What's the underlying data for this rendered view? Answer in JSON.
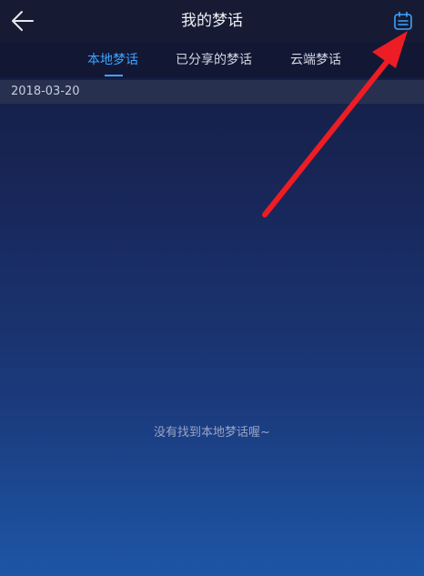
{
  "header": {
    "title": "我的梦话"
  },
  "tabs": [
    {
      "label": "本地梦话",
      "active": true
    },
    {
      "label": "已分享的梦话",
      "active": false
    },
    {
      "label": "云端梦话",
      "active": false
    }
  ],
  "date_bar": {
    "date": "2018-03-20"
  },
  "empty_state": {
    "message": "没有找到本地梦话喔~"
  },
  "colors": {
    "accent": "#3ea3ff",
    "arrow": "#ee1c24"
  },
  "icons": {
    "back": "back-arrow-icon",
    "calendar": "calendar-icon"
  }
}
